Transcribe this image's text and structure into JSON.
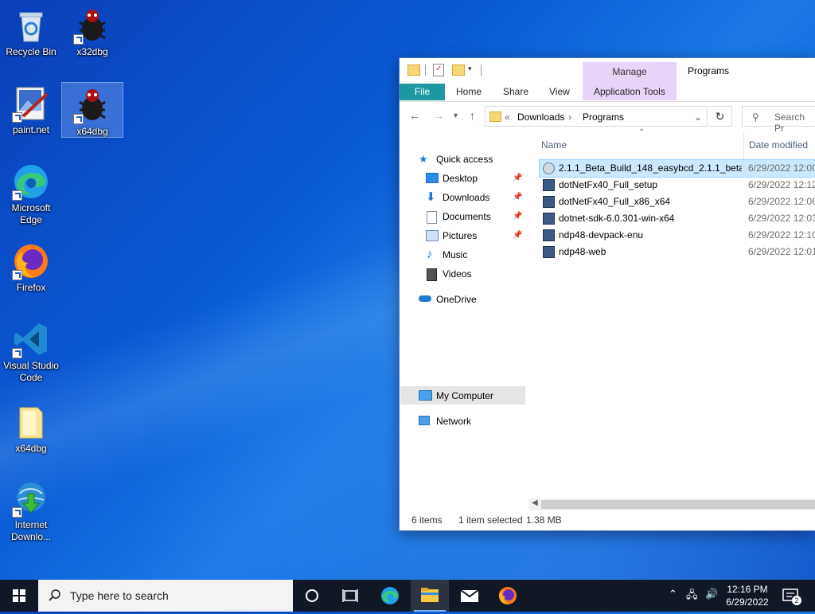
{
  "desktop": {
    "icons": [
      {
        "label": "Recycle Bin"
      },
      {
        "label": "x32dbg"
      },
      {
        "label": "paint.net"
      },
      {
        "label": "x64dbg"
      },
      {
        "label": "Microsoft Edge"
      },
      {
        "label": "Firefox"
      },
      {
        "label": "Visual Studio Code"
      },
      {
        "label": "x64dbg"
      },
      {
        "label": "Internet Downlo..."
      }
    ]
  },
  "explorer": {
    "contextual_tab": "Manage",
    "title": "Programs",
    "ribbon_tabs": [
      "File",
      "Home",
      "Share",
      "View",
      "Application Tools"
    ],
    "breadcrumb": {
      "overflow": "«",
      "items": [
        "Downloads",
        "Programs"
      ]
    },
    "search_placeholder": "Search Pr",
    "nav": {
      "quick_access": "Quick access",
      "items": [
        {
          "label": "Desktop",
          "pinned": true
        },
        {
          "label": "Downloads",
          "pinned": true
        },
        {
          "label": "Documents",
          "pinned": true
        },
        {
          "label": "Pictures",
          "pinned": true
        },
        {
          "label": "Music",
          "pinned": false
        },
        {
          "label": "Videos",
          "pinned": false
        }
      ],
      "onedrive": "OneDrive",
      "my_computer": "My Computer",
      "network": "Network"
    },
    "columns": {
      "name": "Name",
      "date": "Date modified"
    },
    "files": [
      {
        "name": "2.1.1_Beta_Build_148_easybcd_2.1.1_beta_...",
        "date": "6/29/2022 12:00",
        "selected": true
      },
      {
        "name": "dotNetFx40_Full_setup",
        "date": "6/29/2022 12:12",
        "selected": false
      },
      {
        "name": "dotNetFx40_Full_x86_x64",
        "date": "6/29/2022 12:06",
        "selected": false
      },
      {
        "name": "dotnet-sdk-6.0.301-win-x64",
        "date": "6/29/2022 12:03",
        "selected": false
      },
      {
        "name": "ndp48-devpack-enu",
        "date": "6/29/2022 12:10",
        "selected": false
      },
      {
        "name": "ndp48-web",
        "date": "6/29/2022 12:01",
        "selected": false
      }
    ],
    "status": {
      "count": "6 items",
      "selection": "1 item selected",
      "size": "1.38 MB"
    }
  },
  "taskbar": {
    "search_placeholder": "Type here to search",
    "time": "12:16 PM",
    "date": "6/29/2022",
    "notification_count": "2"
  },
  "colors": {
    "accent": "#1c9aa0",
    "manage": "#e8d4f7",
    "taskbar": "#101826",
    "selection": "#cce8ff"
  }
}
